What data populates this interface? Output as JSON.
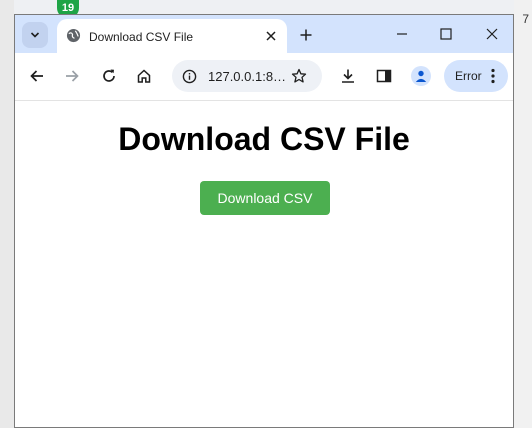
{
  "background": {
    "badge_count": "19",
    "right_number": "7"
  },
  "tab": {
    "title": "Download CSV File"
  },
  "toolbar": {
    "url": "127.0.0.1:8…",
    "profile_status": "Error"
  },
  "page": {
    "heading": "Download CSV File",
    "button_label": "Download CSV"
  },
  "colors": {
    "tabstrip": "#d3e3fd",
    "button": "#4caf50",
    "button_text": "#ffffff"
  },
  "icons": {
    "tab_favicon": "globe-icon",
    "tab_close": "close-icon",
    "new_tab": "plus-icon",
    "minimize": "minimize-icon",
    "maximize": "maximize-icon",
    "close_window": "close-icon",
    "back": "arrow-left-icon",
    "forward": "arrow-right-icon",
    "reload": "reload-icon",
    "home": "home-icon",
    "site_info": "info-icon",
    "bookmark": "star-icon",
    "downloads": "download-icon",
    "side_panel": "side-panel-icon",
    "profile": "person-icon",
    "menu": "kebab-menu-icon"
  }
}
